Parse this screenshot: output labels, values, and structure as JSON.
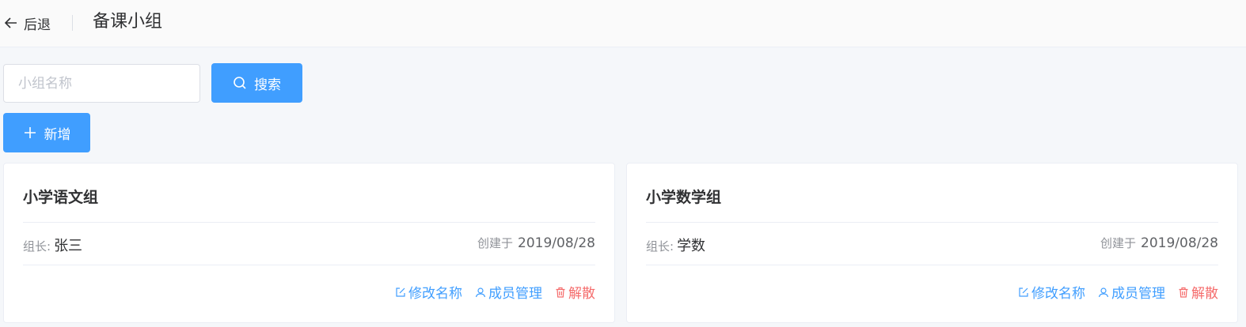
{
  "header": {
    "back_label": "后退",
    "title": "备课小组"
  },
  "search": {
    "placeholder": "小组名称",
    "value": "",
    "search_label": "搜索"
  },
  "toolbar": {
    "add_label": "新增"
  },
  "groups": [
    {
      "name": "小学语文组",
      "leader_label": "组长:",
      "leader": "张三",
      "created_label": "创建于",
      "created_date": "2019/08/28",
      "actions": {
        "rename": "修改名称",
        "members": "成员管理",
        "dissolve": "解散"
      }
    },
    {
      "name": "小学数学组",
      "leader_label": "组长:",
      "leader": "学数",
      "created_label": "创建于",
      "created_date": "2019/08/28",
      "actions": {
        "rename": "修改名称",
        "members": "成员管理",
        "dissolve": "解散"
      }
    }
  ],
  "colors": {
    "primary": "#409eff",
    "danger": "#f56c6c",
    "background": "#f5f7fa"
  },
  "icons": {
    "back": "arrow-left-icon",
    "search": "search-icon",
    "add": "plus-icon",
    "rename": "edit-icon",
    "members": "user-icon",
    "dissolve": "trash-icon"
  }
}
